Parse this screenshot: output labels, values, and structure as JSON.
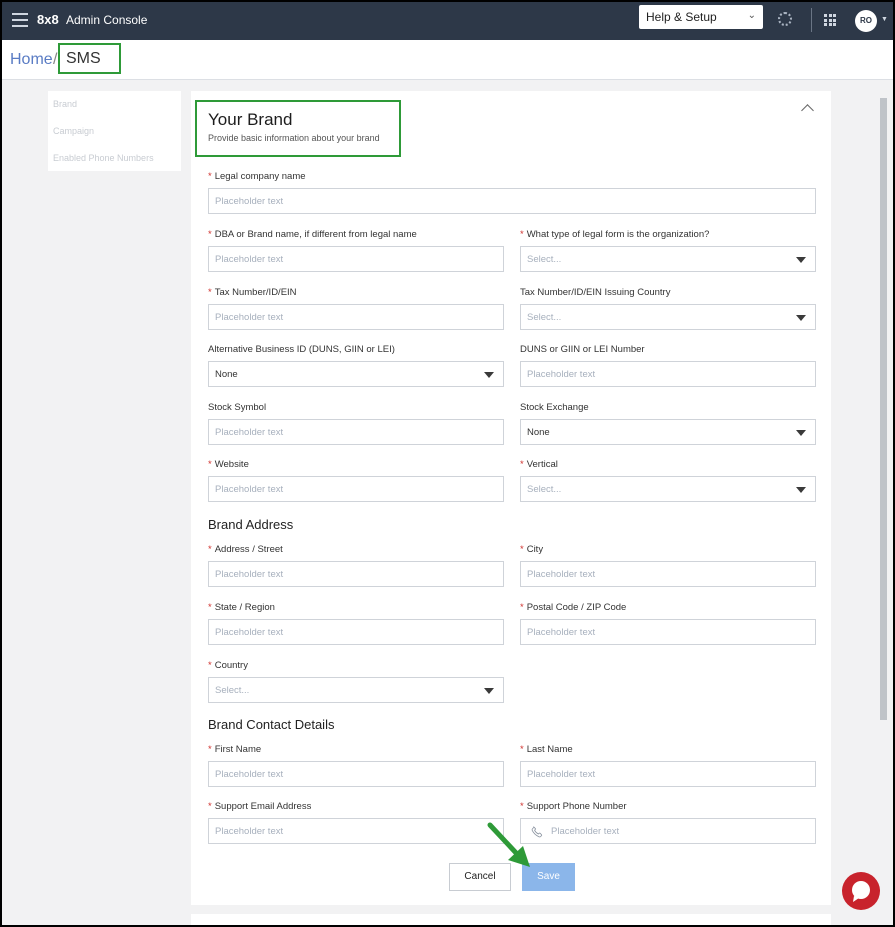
{
  "app": {
    "logo": "8x8",
    "title": "Admin Console"
  },
  "header": {
    "help_label": "Help & Setup",
    "avatar_initials": "RO"
  },
  "breadcrumb": {
    "home": "Home",
    "separator": "/",
    "current": "SMS"
  },
  "leftnav": {
    "items": [
      "Brand",
      "Campaign",
      "Enabled Phone Numbers"
    ]
  },
  "brand": {
    "title": "Your Brand",
    "subtitle": "Provide basic information about your brand",
    "fields": {
      "legal_name": {
        "label": "Legal company name",
        "placeholder": "Placeholder text"
      },
      "dba": {
        "label": "DBA or Brand name, if different from legal name",
        "placeholder": "Placeholder text"
      },
      "legal_form": {
        "label": "What type of legal form is the organization?",
        "value": "Select..."
      },
      "tax_number": {
        "label": "Tax Number/ID/EIN",
        "placeholder": "Placeholder text"
      },
      "tax_country": {
        "label": "Tax Number/ID/EIN Issuing Country",
        "value": "Select..."
      },
      "alt_business_id": {
        "label": "Alternative Business ID (DUNS, GIIN or LEI)",
        "value": "None"
      },
      "duns_number": {
        "label": "DUNS or GIIN or LEI Number",
        "placeholder": "Placeholder text"
      },
      "stock_symbol": {
        "label": "Stock Symbol",
        "placeholder": "Placeholder text"
      },
      "stock_exchange": {
        "label": "Stock Exchange",
        "value": "None"
      },
      "website": {
        "label": "Website",
        "placeholder": "Placeholder text"
      },
      "vertical": {
        "label": "Vertical",
        "value": "Select..."
      }
    }
  },
  "address": {
    "heading": "Brand Address",
    "fields": {
      "street": {
        "label": "Address / Street",
        "placeholder": "Placeholder text"
      },
      "city": {
        "label": "City",
        "placeholder": "Placeholder text"
      },
      "state": {
        "label": "State / Region",
        "placeholder": "Placeholder text"
      },
      "postal": {
        "label": "Postal Code / ZIP Code",
        "placeholder": "Placeholder text"
      },
      "country": {
        "label": "Country",
        "value": "Select..."
      }
    }
  },
  "contact": {
    "heading": "Brand Contact Details",
    "fields": {
      "first_name": {
        "label": "First Name",
        "placeholder": "Placeholder text"
      },
      "last_name": {
        "label": "Last Name",
        "placeholder": "Placeholder text"
      },
      "support_email": {
        "label": "Support Email Address",
        "placeholder": "Placeholder text"
      },
      "support_phone": {
        "label": "Support Phone Number",
        "placeholder": "Placeholder text"
      }
    }
  },
  "actions": {
    "cancel": "Cancel",
    "save": "Save"
  },
  "required_marker": "*",
  "colors": {
    "topbar": "#2d3848",
    "accent_link": "#5a7cc4",
    "save_button": "#8bb6ea",
    "highlight": "#2e9a38",
    "required": "#d0312d",
    "chat": "#c8232c"
  },
  "icons": {
    "menu": "hamburger-icon",
    "apps": "grid-icon",
    "phone": "phone-icon",
    "collapse": "chevron-up-icon",
    "chat": "chat-icon",
    "dropdown": "caret-down-icon"
  }
}
